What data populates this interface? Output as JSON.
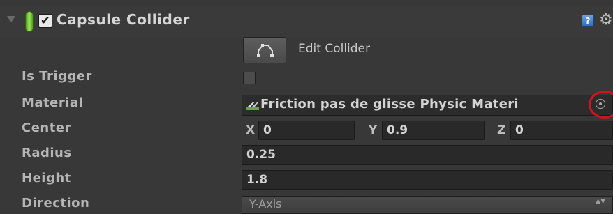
{
  "component": {
    "title": "Capsule Collider",
    "enabled": true,
    "enabled_glyph": "✔",
    "help_glyph": "?",
    "gear_glyph": "⚙",
    "icons": {
      "foldout": "foldout-arrow-icon",
      "component": "capsule-icon",
      "help": "help-icon",
      "settings": "gear-icon"
    }
  },
  "edit_collider": {
    "label": "Edit Collider",
    "icon": "edit-collider-icon"
  },
  "properties": {
    "is_trigger": {
      "label": "Is Trigger",
      "checked": false
    },
    "material": {
      "label": "Material",
      "value": "Friction pas de glisse Physic Materi",
      "icon": "physic-material-icon",
      "picker_icon": "object-picker-icon"
    },
    "center": {
      "label": "Center",
      "x_label": "X",
      "x": "0",
      "y_label": "Y",
      "y": "0.9",
      "z_label": "Z",
      "z": "0"
    },
    "radius": {
      "label": "Radius",
      "value": "0.25"
    },
    "height": {
      "label": "Height",
      "value": "1.8"
    },
    "direction": {
      "label": "Direction",
      "value": "Y-Axis",
      "arrows": "▲▼"
    }
  },
  "colors": {
    "background": "#383838",
    "field": "#292929",
    "label": "#b5b5b5",
    "capsule_green": "#7ccc3c",
    "highlight_ring": "#d0141e"
  }
}
